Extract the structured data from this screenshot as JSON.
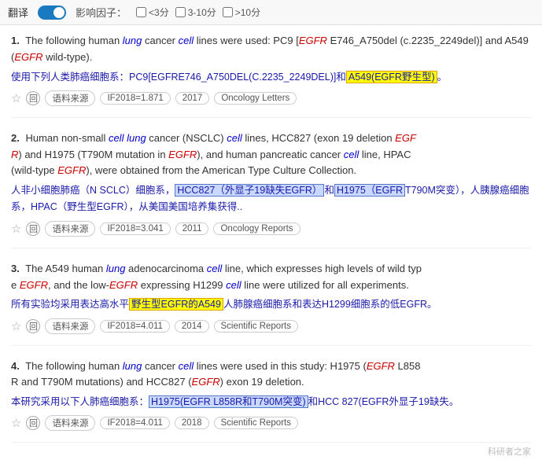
{
  "topbar": {
    "translate_label": "翻译",
    "toggle_state": "on",
    "filter_label": "影响因子：",
    "filters": [
      {
        "id": "f1",
        "label": "<3分"
      },
      {
        "id": "f2",
        "label": "3-10分"
      },
      {
        "id": "f3",
        "label": ">10分"
      }
    ]
  },
  "results": [
    {
      "number": "1.",
      "english": "The following human {lung} cancer {cell} lines were used: PC9 [{EGFR} E746_A750del (c.2235_2249del)] and A549 ({EGFR} wild-type).",
      "chinese": "使用下列人类肺癌细胞系：PC9[EGFRE746_A750DEL(C.2235_2249DEL)]和{A549(EGFR野生型)}。",
      "meta": {
        "if_value": "IF2018=1.871",
        "year": "2017",
        "journal": "Oncology Letters"
      }
    },
    {
      "number": "2.",
      "english": "Human non-small {cell} {lung} cancer (NSCLC) {cell} lines, {HCC827} (exon 19 deletion {EGFR}) and H1975 (T790M mutation in {EGFR}), and human pancreatic cancer {cell} line, HPAC (wild-type {EGFR}), were obtained from the American Type Culture Collection.",
      "chinese": "人非小细胞肺癌（N SCLC）细胞系，{HCC827（外显子19缺失EGFR）}和{H1975（EGFR}T790M突变），人胰腺癌细胞系，HPAC（野生型EGFR），从美国美国培养集获得..",
      "meta": {
        "if_value": "IF2018=3.041",
        "year": "2011",
        "journal": "Oncology Reports"
      }
    },
    {
      "number": "3.",
      "english": "The A549 human {lung} adenocarcinoma {cell} line, which expresses high levels of wild type {EGFR}, and the low-{EGFR} expressing H1299 {cell} line were utilized for all experiments.",
      "chinese": "所有实验均采用表达高水平{野生型EGFR的A549}人肺腺癌细胞系和表达H1299细胞系的低EGFR。",
      "meta": {
        "if_value": "IF2018=4.011",
        "year": "2014",
        "journal": "Scientific Reports"
      }
    },
    {
      "number": "4.",
      "english": "The following human {lung} cancer {cell} lines were used in this study: H1975 ({EGFR} L858R and T790M mutations) and HCC827 ({EGFR} exon 19 deletion.",
      "chinese": "本研究采用以下人肺癌细胞系：{H1975(EGFR L858R和T790M突变)}和HCC 827(EGFR外显子19缺失。",
      "meta": {
        "if_value": "IF2018=4.011",
        "year": "2018",
        "journal": "Scientific Reports"
      }
    }
  ],
  "watermark": "科研者之家"
}
